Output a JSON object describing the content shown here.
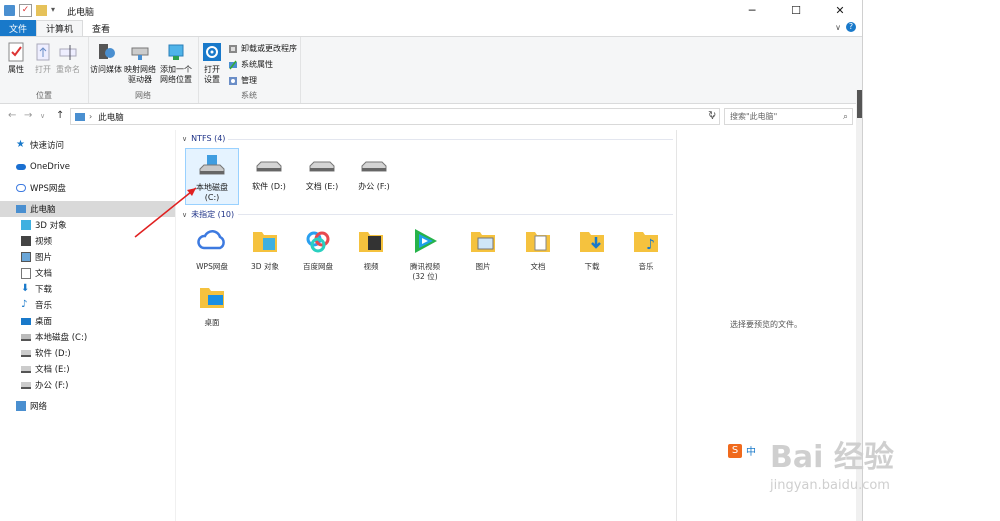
{
  "window": {
    "title": "此电脑",
    "minimize": "─",
    "maximize": "☐",
    "close": "✕"
  },
  "ribbon_tabs": {
    "file": "文件",
    "computer": "计算机",
    "view": "查看"
  },
  "ribbon": {
    "location_group": "位置",
    "properties": "属性",
    "open": "打开",
    "rename": "重命名",
    "network_group": "网络",
    "access_media": "访问媒体",
    "map_drive_1": "映射网络",
    "map_drive_2": "驱动器",
    "add_location_1": "添加一个",
    "add_location_2": "网络位置",
    "system_group": "系统",
    "open_settings_1": "打开",
    "open_settings_2": "设置",
    "uninstall": "卸载或更改程序",
    "system_properties": "系统属性",
    "manage": "管理"
  },
  "address": {
    "path": "此电脑",
    "search_placeholder": "搜索\"此电脑\""
  },
  "nav": {
    "quick_access": "快速访问",
    "onedrive": "OneDrive",
    "wps": "WPS网盘",
    "this_pc": "此电脑",
    "objects3d": "3D 对象",
    "videos": "视频",
    "pictures": "图片",
    "documents": "文档",
    "downloads": "下载",
    "music": "音乐",
    "desktop": "桌面",
    "drive_c": "本地磁盘 (C:)",
    "drive_d": "软件 (D:)",
    "drive_e": "文档 (E:)",
    "drive_f": "办公 (F:)",
    "network": "网络"
  },
  "sections": {
    "ntfs": "NTFS (4)",
    "unspecified": "未指定 (10)"
  },
  "drives": {
    "c1": "本地磁盘",
    "c2": "(C:)",
    "d": "软件 (D:)",
    "e": "文档 (E:)",
    "f": "办公 (F:)"
  },
  "folders": {
    "wps": "WPS网盘",
    "objects3d": "3D 对象",
    "baidu": "百度网盘",
    "videos": "视频",
    "tencent_1": "腾讯视频",
    "tencent_2": "(32 位)",
    "pictures": "图片",
    "documents": "文档",
    "downloads": "下载",
    "music": "音乐",
    "desktop": "桌面"
  },
  "preview": {
    "text": "选择要预览的文件。"
  },
  "watermark": {
    "brand": "Bai 经验",
    "url": "jingyan.baidu.com",
    "ime": "中"
  },
  "colors": {
    "accent": "#1979ca",
    "selected": "#d9d9d9",
    "folder": "#f5c23e",
    "arrow": "#e02020"
  }
}
